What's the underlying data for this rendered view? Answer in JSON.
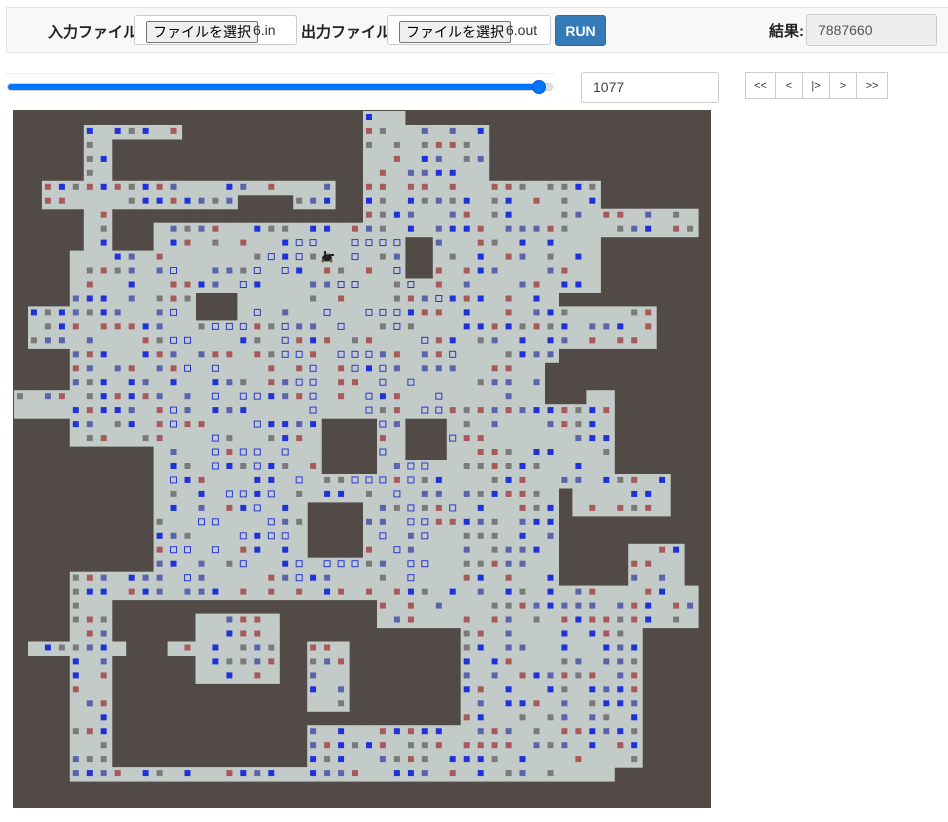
{
  "toolbar": {
    "input_label": "入力ファイル",
    "input_button": "ファイルを選択",
    "input_file": "6.in",
    "output_label": "出力ファイル",
    "output_button": "ファイルを選択",
    "output_file": "6.out",
    "run_label": "RUN",
    "result_label": "結果:",
    "result_value": "7887660"
  },
  "player": {
    "turn": "1077",
    "progress": 0.975,
    "nav": [
      "<<",
      "<",
      "|>",
      ">",
      ">>"
    ]
  },
  "colors": {
    "wall": "#524a47",
    "floor": "#c3cbc8",
    "item_red": "#a85a5a",
    "item_grey": "#7a7a7a",
    "item_blue": "#1e32d8",
    "item_slate": "#5a64aa",
    "outline_blue": "#2a3ad0",
    "accent": "#337ab7"
  },
  "board_icons": [
    "robot-icon"
  ]
}
